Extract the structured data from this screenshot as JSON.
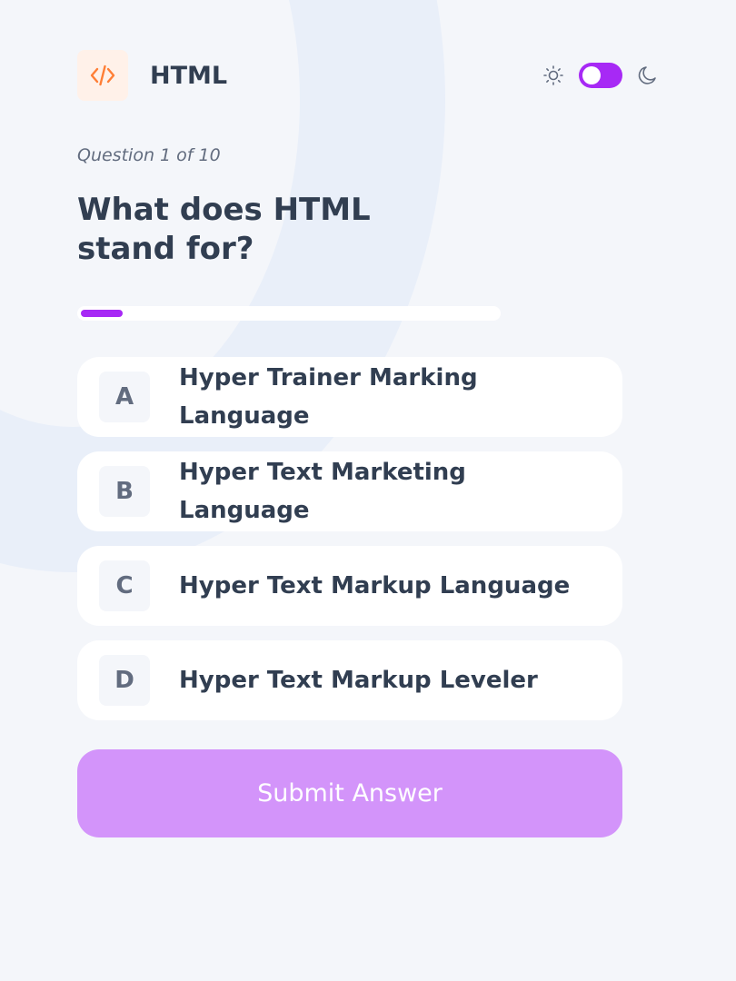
{
  "header": {
    "subject_title": "HTML",
    "subject_icon": "code-icon",
    "subject_icon_bg": "#FFF1E9",
    "subject_icon_color": "#FF7E35",
    "theme_toggle": {
      "light_icon": "sun-icon",
      "dark_icon": "moon-icon",
      "state": "light",
      "accent": "#A729F5"
    }
  },
  "quiz": {
    "counter": "Question 1 of 10",
    "question": "What does HTML stand for?",
    "progress": {
      "current": 1,
      "total": 10,
      "fraction": 0.1
    },
    "options": [
      {
        "letter": "A",
        "text": "Hyper Trainer Marking Language"
      },
      {
        "letter": "B",
        "text": "Hyper Text Marketing Language"
      },
      {
        "letter": "C",
        "text": "Hyper Text Markup Language"
      },
      {
        "letter": "D",
        "text": "Hyper Text Markup Leveler"
      }
    ],
    "submit_label": "Submit Answer"
  },
  "colors": {
    "background": "#F4F6FA",
    "text_dark": "#313E51",
    "text_muted": "#626C7F",
    "accent_purple": "#A729F5",
    "submit_disabled": "#D394FA"
  }
}
